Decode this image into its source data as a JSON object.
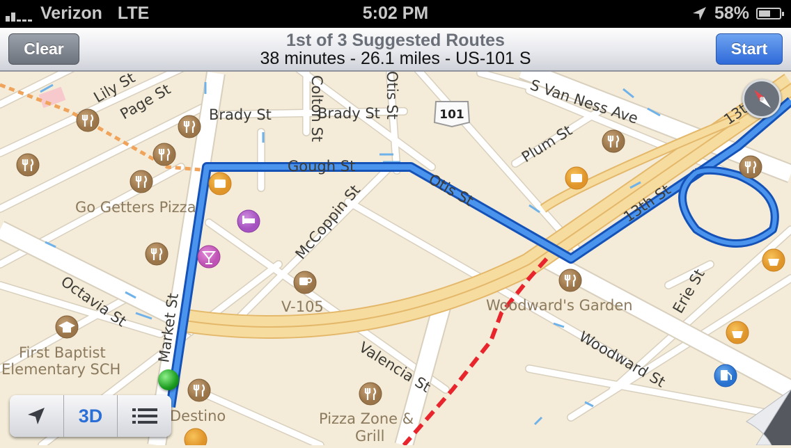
{
  "status_bar": {
    "carrier": "Verizon",
    "network": "LTE",
    "signal_bars_filled": 2,
    "signal_bars_total": 5,
    "time": "5:02 PM",
    "location_services_icon": "location-arrow-icon",
    "battery_percent_text": "58%",
    "battery_level": 0.58
  },
  "nav_bar": {
    "clear_label": "Clear",
    "start_label": "Start",
    "title": "1st of 3 Suggested Routes",
    "subtitle": "38 minutes - 26.1 miles - US-101 S"
  },
  "map": {
    "colors": {
      "land": "#f4ecd8",
      "street": "#ffffff",
      "street_edge": "#d8cfbd",
      "freeway": "#f7dca0",
      "freeway_edge": "#e4b86a",
      "route": "#2f7de1",
      "route_edge": "#1552b8",
      "transit_dotted": "#f0a35a",
      "traffic_red": "#e8242c",
      "oneway_arrow": "#6fb2ea"
    },
    "highway_shield": "101",
    "streets": [
      "Lily St",
      "Page St",
      "Brady St",
      "Brady St",
      "Colton St",
      "Otis St",
      "S Van Ness Ave",
      "Plum St",
      "Gough St",
      "Otis St",
      "McCoppin St",
      "13th St",
      "13th St",
      "Octavia St",
      "Market St",
      "Valencia St",
      "Erie St",
      "Woodward St"
    ],
    "pois": [
      {
        "name": "Go Getters Pizza",
        "type": "restaurant"
      },
      {
        "name": "V-105",
        "type": "cafe"
      },
      {
        "name": "First Baptist",
        "name2": "Elementary SCH",
        "type": "school"
      },
      {
        "name": "Woodward's Garden",
        "type": "restaurant"
      },
      {
        "name": "Pizza Zone &",
        "name2": "Grill",
        "type": "restaurant"
      },
      {
        "name": "Destino",
        "type": "restaurant"
      }
    ]
  },
  "controls": {
    "location_button": "location-arrow-icon",
    "three_d_label": "3D",
    "list_button": "list-icon"
  }
}
